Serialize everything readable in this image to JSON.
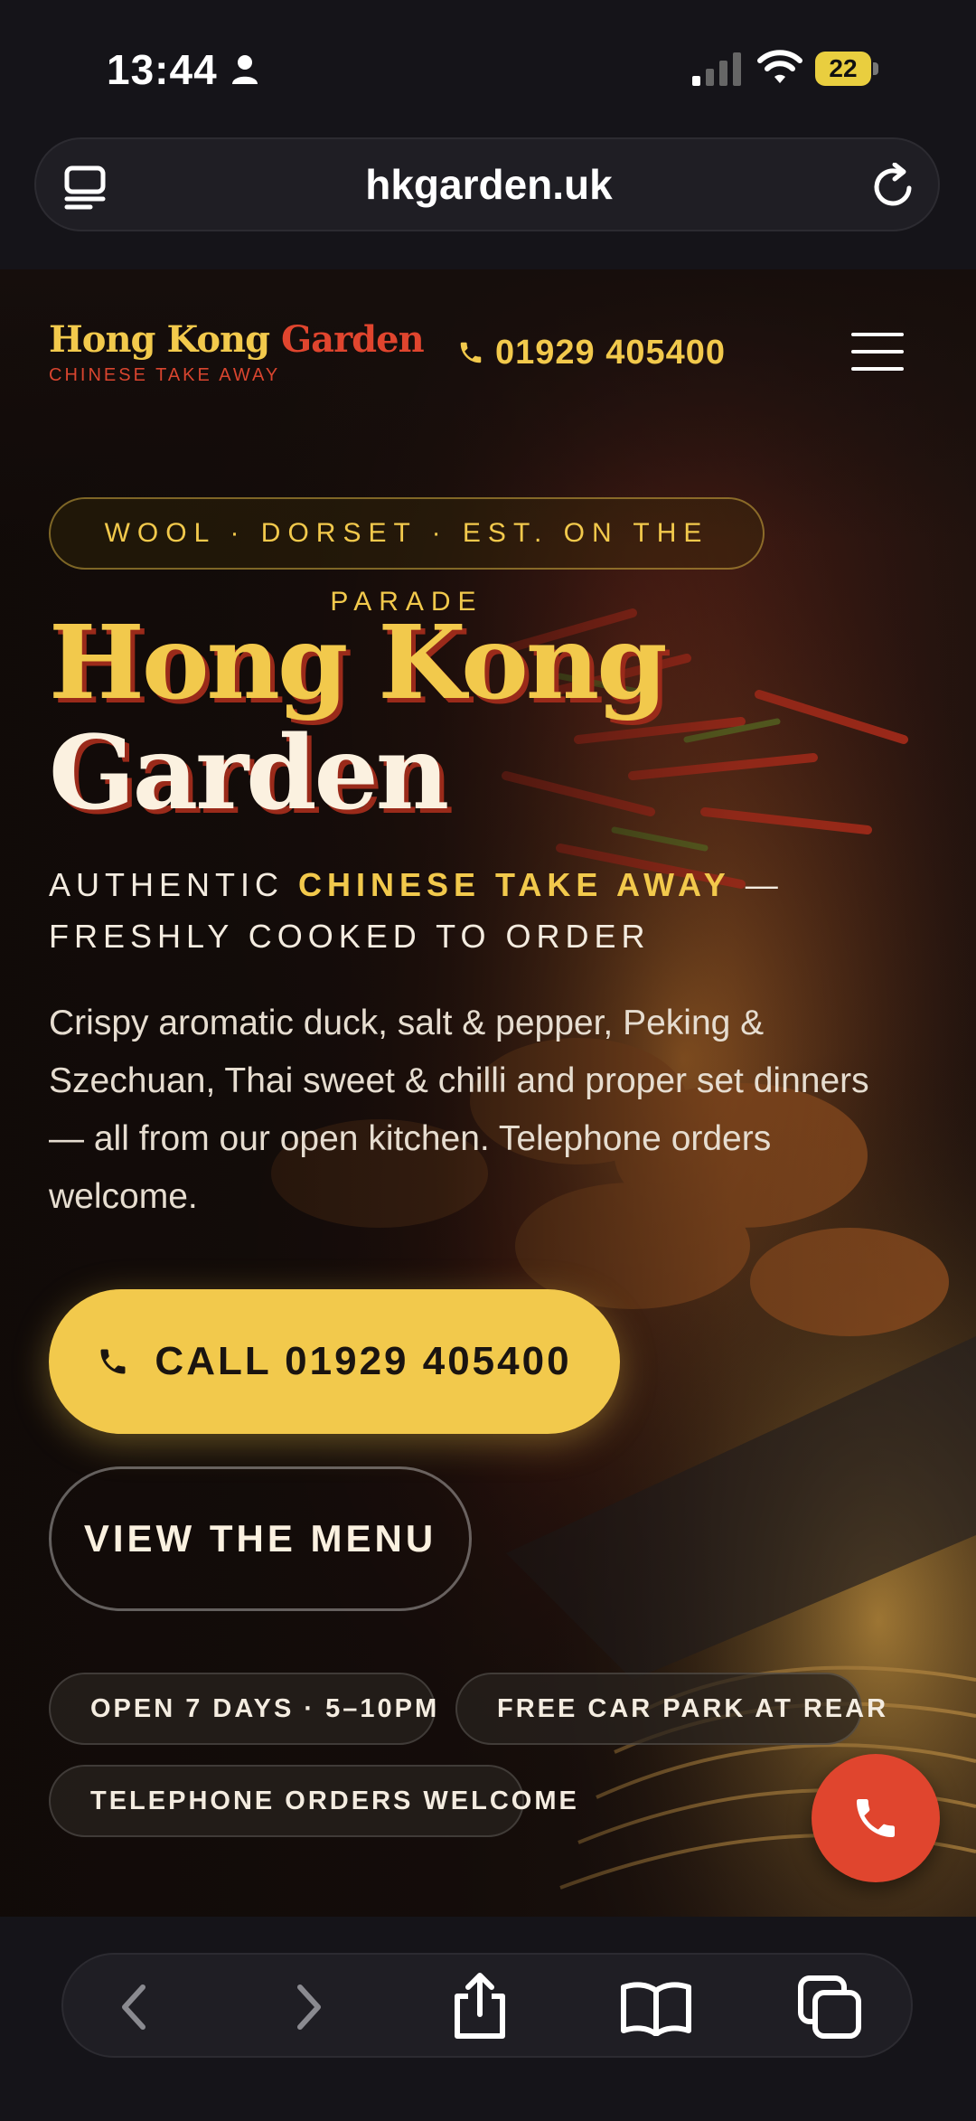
{
  "status_bar": {
    "time": "13:44",
    "battery": "22"
  },
  "browser": {
    "url": "hkgarden.uk"
  },
  "site": {
    "logo": {
      "name_part1": "Hong Kong",
      "name_part2": "Garden",
      "subtitle": "CHINESE TAKE AWAY"
    },
    "header_phone": "01929 405400",
    "badge": "WOOL · DORSET · EST. ON THE PARADE",
    "title_line1": "Hong Kong",
    "title_line2": "Garden",
    "tagline": {
      "prefix": "AUTHENTIC",
      "highlight": "CHINESE TAKE AWAY",
      "suffix": "— FRESHLY COOKED TO ORDER"
    },
    "description": "Crispy aromatic duck, salt & pepper, Peking & Szechuan, Thai sweet & chilli and proper set dinners — all from our open kitchen. Telephone orders welcome.",
    "call_button": "CALL 01929 405400",
    "menu_button": "VIEW THE MENU",
    "chips": {
      "open": "OPEN 7 DAYS · 5–10PM",
      "parking": "FREE CAR PARK AT REAR",
      "telephone": "TELEPHONE ORDERS WELCOME"
    }
  },
  "icons": {
    "status": [
      "person-icon",
      "signal-icon",
      "wifi-icon",
      "battery-icon"
    ],
    "browser": [
      "tabs-icon",
      "reload-icon",
      "back-icon",
      "forward-icon",
      "share-icon",
      "bookmarks-icon",
      "tabs-overview-icon"
    ],
    "site": [
      "phone-icon",
      "hamburger-menu-icon",
      "clock-icon",
      "parking-icon",
      "delivery-truck-icon"
    ]
  },
  "colors": {
    "accent_gold": "#f2c94c",
    "accent_red": "#e0452e",
    "background": "#151419"
  }
}
